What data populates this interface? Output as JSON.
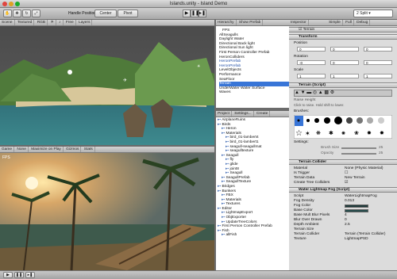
{
  "window": {
    "title": "Islands.unity - Island Demo"
  },
  "toolbar": {
    "handle_position_label": "Handle Position:",
    "center_label": "Center",
    "pivot_label": "Pivot",
    "layout_select": "2 Split"
  },
  "scene": {
    "tab": "Scene",
    "render_mode": "Textured",
    "color_mode": "RGB",
    "free_label": "Free",
    "layers_label": "Layers"
  },
  "game": {
    "tab": "Game",
    "aspect": "None",
    "maximize_label": "Maximize on Play",
    "gizmos_label": "Gizmos",
    "stats_label": "Stats",
    "fps_label": "FPS"
  },
  "hierarchy": {
    "tab": "Hierarchy",
    "show_prefab": "Show Prefab",
    "items": [
      "FPS",
      "AllSeagulls",
      "Daylight Water",
      "Directional Back light",
      "Directional Sun light",
      "First Person Controller Prefab",
      "HeronColliders",
      "HeronPrefab",
      "HeronPrefab",
      "LevelObjects",
      "Performance",
      "SeaFloor",
      "Terrain",
      "UnderWater Water Surface",
      "Waves"
    ],
    "selected_index": 12
  },
  "project": {
    "tab": "Project",
    "settings_label": "Settings...",
    "create_label": "Create",
    "items": [
      "AirplaneRuins",
      "Birds",
      "Heron",
      "Materials",
      "bird_01-lambert4",
      "bird_01-lambert1",
      "seagull-seagullmat",
      "seagulltexture",
      "Seagull",
      "fly",
      "glide",
      "joint8",
      "Seagull",
      "SeagullPrefab",
      "SeagullTexture",
      "Bridges",
      "Bunkers",
      "FBX",
      "Materials",
      "Textures",
      "Editor",
      "LightmapExport",
      "ObjExporter",
      "UpdateTreeColors",
      "First Person Controller Prefab",
      "Fish",
      "allFish"
    ]
  },
  "inspector": {
    "tab": "Inspector",
    "simple": "Simple",
    "full": "Full",
    "debug": "Debug",
    "object_name": "Terrain",
    "transform_label": "Transform",
    "position_label": "Position",
    "rotation_label": "Rotation",
    "scale_label": "Scale",
    "pos": [
      "0",
      "0",
      "0"
    ],
    "rot": [
      "-0",
      "0",
      "0"
    ],
    "scl": [
      "1",
      "1",
      "1"
    ],
    "terrain_script": "Terrain (Script)",
    "raise_height": "Raise Height",
    "raise_help": "Click to raise. Hold shift to lower.",
    "brushes_label": "Brushes:",
    "settings_label": "Settings:",
    "brush_size_label": "Brush Size",
    "brush_size_val": "25",
    "opacity_label": "Opacity",
    "opacity_val": "25",
    "collider_label": "Terrain Collider",
    "material_label": "Material",
    "material_val": "None (Physic Material)",
    "is_trigger_label": "Is Trigger",
    "terrain_data_label": "Terrain Data",
    "terrain_data_val": "New Terrain",
    "create_trees_label": "Create Tree Colliders",
    "water_script": "Water Lightmap Fog (Script)",
    "script_label": "Script",
    "script_val": "WaterLightmapFog",
    "fog_density_label": "Fog Density",
    "fog_density_val": "0.013",
    "fog_color_label": "Fog Color",
    "base_color_label": "Base Color",
    "base_mult_label": "Base Mult Blur Pixels",
    "base_mult_val": "4",
    "blur_over_label": "Blur Over Drawn",
    "blur_over_val": "0",
    "depth_ambient_label": "Depth Ambient",
    "depth_ambient_val": "2.5",
    "terrain_size_label": "Terrain Size",
    "terrain_collider_label": "Terrain Collider",
    "terrain_collider_val": "Terrain (Terrain Collider)",
    "texture_label": "Texture",
    "texture_val": "LightmapPSD"
  },
  "colors": {
    "selection": "#3875d7",
    "panel": "#dcdcdc",
    "inspector_header": "#bfbfbf"
  }
}
